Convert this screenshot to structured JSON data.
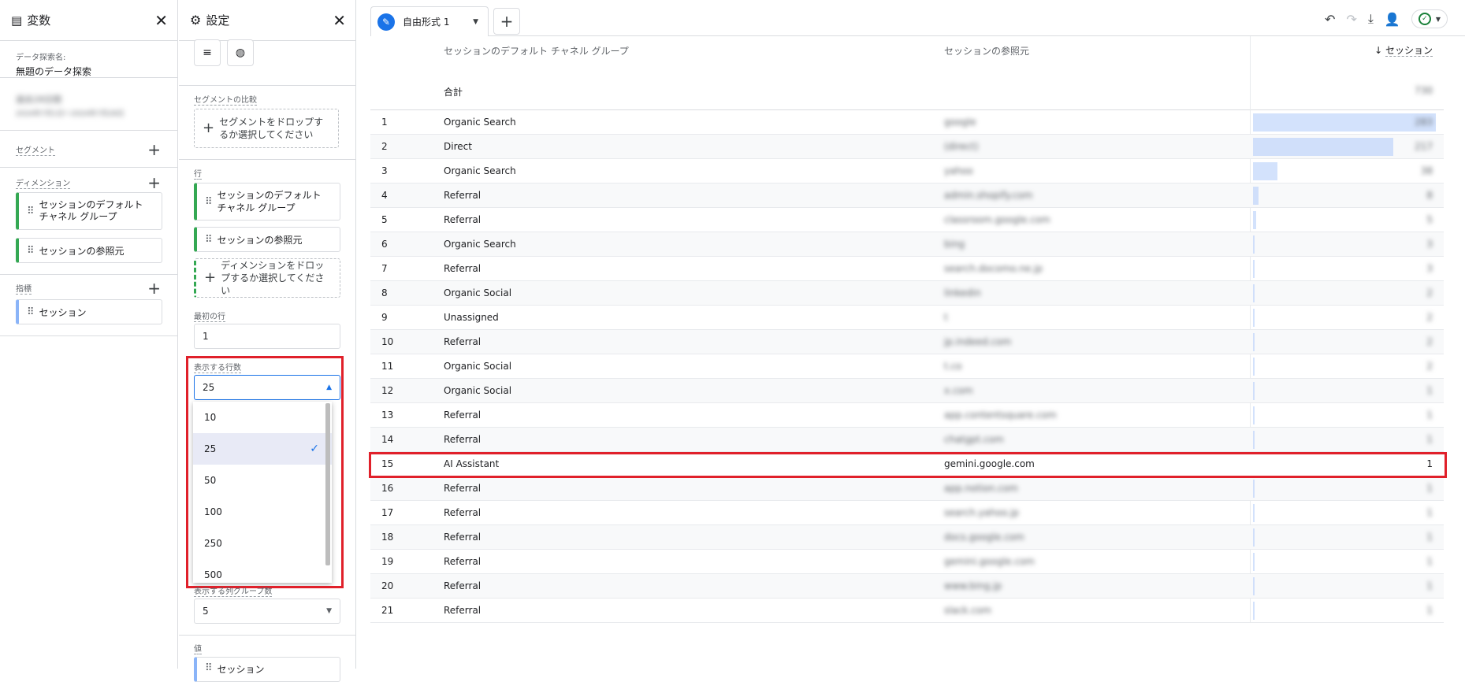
{
  "variables_panel": {
    "title": "変数",
    "exploration_name_label": "データ探索名:",
    "exploration_name": "無題のデータ探索",
    "date_blurred_line1": "過去28日間",
    "date_blurred_line2": "2024年7月1日〜2024年7月28日",
    "segments_label": "セグメント",
    "dimensions_label": "ディメンション",
    "dimensions": [
      "セッションのデフォルト チャネル グループ",
      "セッションの参照元"
    ],
    "metrics_label": "指標",
    "metrics": [
      "セッション"
    ]
  },
  "settings_panel": {
    "title": "設定",
    "segment_compare_label": "セグメントの比較",
    "segment_drop_text": "セグメントをドロップするか選択してください",
    "rows_label": "行",
    "row_dimensions": [
      "セッションのデフォルト チャネル グループ",
      "セッションの参照元"
    ],
    "dimension_drop_text": "ディメンションをドロップするか選択してください",
    "first_row_label": "最初の行",
    "first_row_value": "1",
    "rows_to_show_label": "表示する行数",
    "rows_to_show_value": "25",
    "rows_options": [
      "10",
      "25",
      "50",
      "100",
      "250",
      "500"
    ],
    "column_groups_label": "表示する列グループ数",
    "column_groups_value": "5",
    "values_label": "値",
    "values_chip": "セッション"
  },
  "main": {
    "tab_label": "自由形式 1",
    "table": {
      "col_channel": "セッションのデフォルト チャネル グループ",
      "col_source": "セッションの参照元",
      "col_sessions": "セッション",
      "total_label": "合計",
      "total_value_blurred": "730",
      "rows": [
        {
          "idx": "1",
          "channel": "Organic Search",
          "source": "google",
          "value": "283"
        },
        {
          "idx": "2",
          "channel": "Direct",
          "source": "(direct)",
          "value": "217"
        },
        {
          "idx": "3",
          "channel": "Organic Search",
          "source": "yahoo",
          "value": "38"
        },
        {
          "idx": "4",
          "channel": "Referral",
          "source": "admin.shopify.com",
          "value": "8"
        },
        {
          "idx": "5",
          "channel": "Referral",
          "source": "classroom.google.com",
          "value": "5"
        },
        {
          "idx": "6",
          "channel": "Organic Search",
          "source": "bing",
          "value": "3"
        },
        {
          "idx": "7",
          "channel": "Referral",
          "source": "search.docomo.ne.jp",
          "value": "3"
        },
        {
          "idx": "8",
          "channel": "Organic Social",
          "source": "linkedin",
          "value": "2"
        },
        {
          "idx": "9",
          "channel": "Unassigned",
          "source": "t",
          "value": "2"
        },
        {
          "idx": "10",
          "channel": "Referral",
          "source": "jp.indeed.com",
          "value": "2"
        },
        {
          "idx": "11",
          "channel": "Organic Social",
          "source": "t.co",
          "value": "2"
        },
        {
          "idx": "12",
          "channel": "Organic Social",
          "source": "x.com",
          "value": "1"
        },
        {
          "idx": "13",
          "channel": "Referral",
          "source": "app.contentsquare.com",
          "value": "1"
        },
        {
          "idx": "14",
          "channel": "Referral",
          "source": "chatgpt.com",
          "value": "1"
        },
        {
          "idx": "15",
          "channel": "AI Assistant",
          "source": "gemini.google.com",
          "value": "1"
        },
        {
          "idx": "16",
          "channel": "Referral",
          "source": "app.notion.com",
          "value": "1"
        },
        {
          "idx": "17",
          "channel": "Referral",
          "source": "search.yahoo.jp",
          "value": "1"
        },
        {
          "idx": "18",
          "channel": "Referral",
          "source": "docs.google.com",
          "value": "1"
        },
        {
          "idx": "19",
          "channel": "Referral",
          "source": "gemini.google.com",
          "value": "1"
        },
        {
          "idx": "20",
          "channel": "Referral",
          "source": "www.bing.jp",
          "value": "1"
        },
        {
          "idx": "21",
          "channel": "Referral",
          "source": "slack.com",
          "value": "1"
        }
      ]
    }
  }
}
